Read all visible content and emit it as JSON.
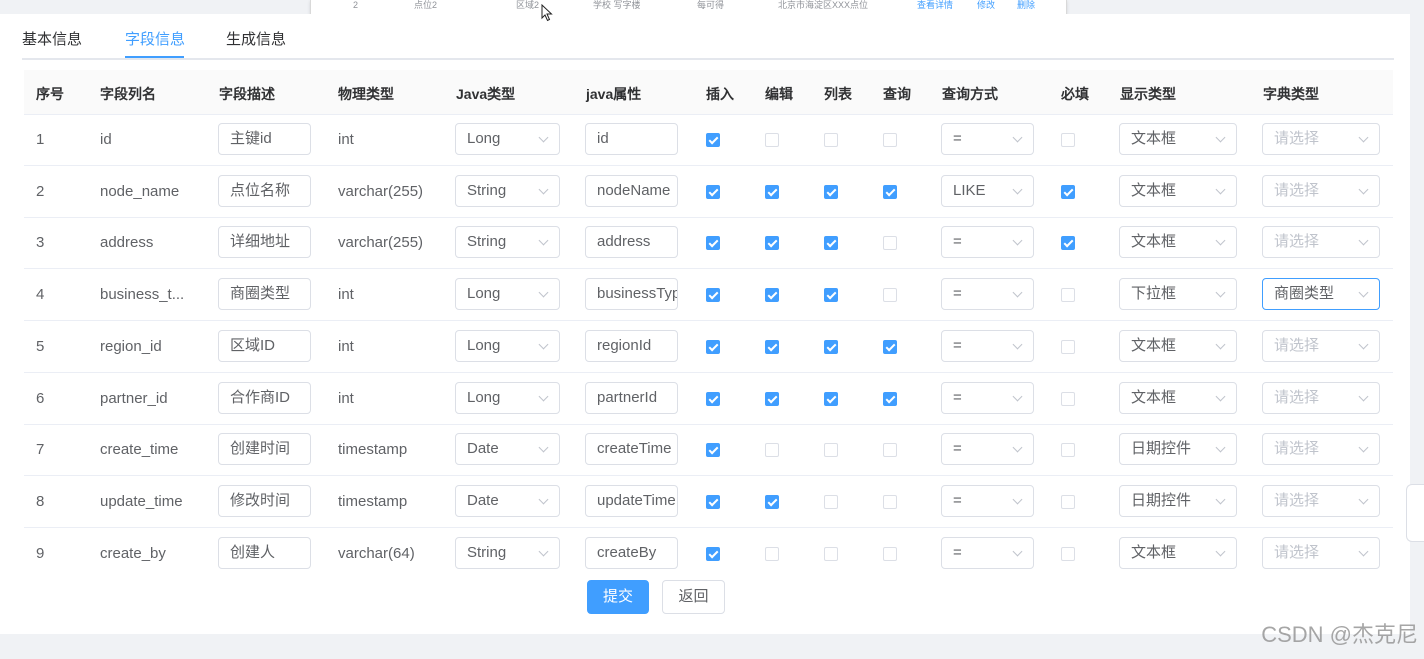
{
  "preview_strip": {
    "cells": [
      "2",
      "点位2",
      "区域2",
      "学校 写字楼",
      "每可得",
      "北京市海淀区XXX点位"
    ],
    "links": [
      "查看详情",
      "修改",
      "删除"
    ]
  },
  "tabs": [
    "基本信息",
    "字段信息",
    "生成信息"
  ],
  "active_tab": "字段信息",
  "columns": [
    "序号",
    "字段列名",
    "字段描述",
    "物理类型",
    "Java类型",
    "java属性",
    "插入",
    "编辑",
    "列表",
    "查询",
    "查询方式",
    "必填",
    "显示类型",
    "字典类型"
  ],
  "dict_placeholder": "请选择",
  "rows": [
    {
      "no": "1",
      "name": "id",
      "desc": "主键id",
      "phys": "int",
      "java_type": "Long",
      "java_prop": "id",
      "insert": true,
      "edit": false,
      "list": false,
      "query": false,
      "query_mode": "=",
      "required": false,
      "display": "文本框",
      "dict": ""
    },
    {
      "no": "2",
      "name": "node_name",
      "desc": "点位名称",
      "phys": "varchar(255)",
      "java_type": "String",
      "java_prop": "nodeName",
      "insert": true,
      "edit": true,
      "list": true,
      "query": true,
      "query_mode": "LIKE",
      "required": true,
      "display": "文本框",
      "dict": ""
    },
    {
      "no": "3",
      "name": "address",
      "desc": "详细地址",
      "phys": "varchar(255)",
      "java_type": "String",
      "java_prop": "address",
      "insert": true,
      "edit": true,
      "list": true,
      "query": false,
      "query_mode": "=",
      "required": true,
      "display": "文本框",
      "dict": ""
    },
    {
      "no": "4",
      "name": "business_t...",
      "desc": "商圈类型",
      "phys": "int",
      "java_type": "Long",
      "java_prop": "businessType",
      "insert": true,
      "edit": true,
      "list": true,
      "query": false,
      "query_mode": "=",
      "required": false,
      "display": "下拉框",
      "dict": "商圈类型"
    },
    {
      "no": "5",
      "name": "region_id",
      "desc": "区域ID",
      "phys": "int",
      "java_type": "Long",
      "java_prop": "regionId",
      "insert": true,
      "edit": true,
      "list": true,
      "query": true,
      "query_mode": "=",
      "required": false,
      "display": "文本框",
      "dict": ""
    },
    {
      "no": "6",
      "name": "partner_id",
      "desc": "合作商ID",
      "phys": "int",
      "java_type": "Long",
      "java_prop": "partnerId",
      "insert": true,
      "edit": true,
      "list": true,
      "query": true,
      "query_mode": "=",
      "required": false,
      "display": "文本框",
      "dict": ""
    },
    {
      "no": "7",
      "name": "create_time",
      "desc": "创建时间",
      "phys": "timestamp",
      "java_type": "Date",
      "java_prop": "createTime",
      "insert": true,
      "edit": false,
      "list": false,
      "query": false,
      "query_mode": "=",
      "required": false,
      "display": "日期控件",
      "dict": ""
    },
    {
      "no": "8",
      "name": "update_time",
      "desc": "修改时间",
      "phys": "timestamp",
      "java_type": "Date",
      "java_prop": "updateTime",
      "insert": true,
      "edit": true,
      "list": false,
      "query": false,
      "query_mode": "=",
      "required": false,
      "display": "日期控件",
      "dict": ""
    },
    {
      "no": "9",
      "name": "create_by",
      "desc": "创建人",
      "phys": "varchar(64)",
      "java_type": "String",
      "java_prop": "createBy",
      "insert": true,
      "edit": false,
      "list": false,
      "query": false,
      "query_mode": "=",
      "required": false,
      "display": "文本框",
      "dict": ""
    }
  ],
  "buttons": {
    "submit": "提交",
    "back": "返回"
  },
  "watermark": "CSDN @杰克尼",
  "colors": {
    "primary": "#409eff",
    "border": "#dcdfe6",
    "placeholder": "#c0c4cc"
  }
}
